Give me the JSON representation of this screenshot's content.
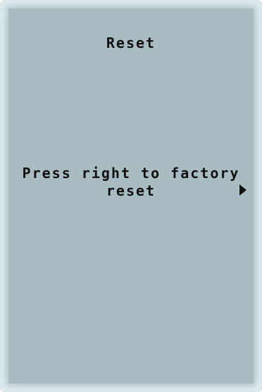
{
  "screen": {
    "title": "Reset",
    "message_line1": "Press right to factory",
    "message_line2": "reset",
    "arrow_icon": "triangle-right-icon"
  },
  "colors": {
    "lcd_background": "#a8bcc2",
    "text": "#111111"
  }
}
